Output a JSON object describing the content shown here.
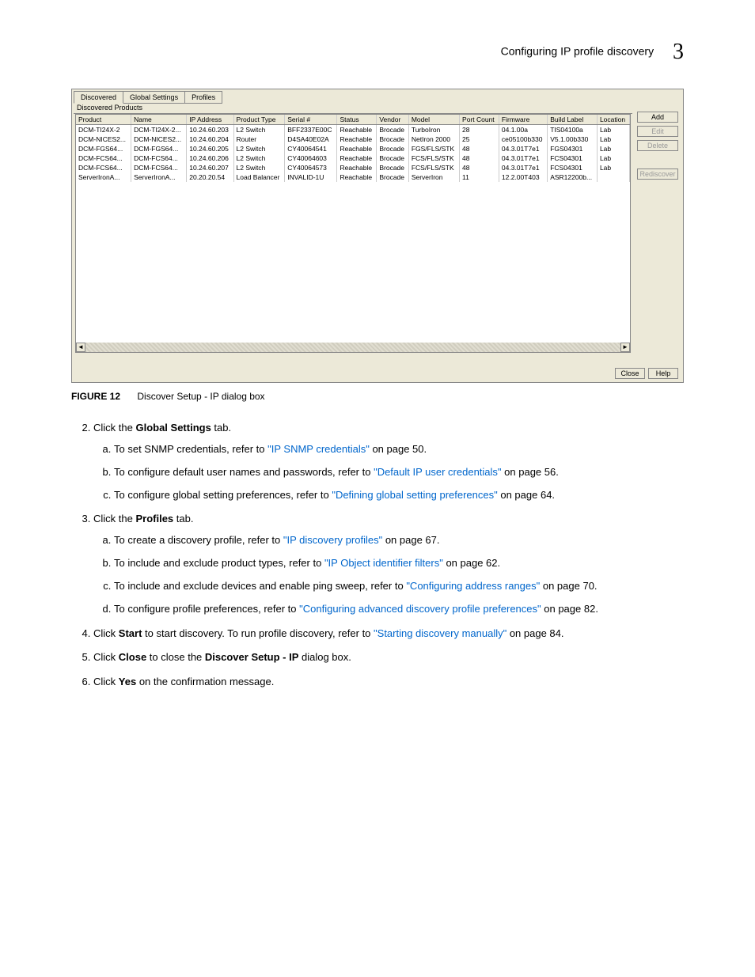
{
  "header": {
    "title": "Configuring IP profile discovery",
    "section": "3"
  },
  "dialog": {
    "tabs": [
      "Discovered",
      "Global Settings",
      "Profiles"
    ],
    "active_tab_index": 0,
    "subheader": "Discovered Products",
    "columns": [
      "Product",
      "Name",
      "IP Address",
      "Product Type",
      "Serial #",
      "Status",
      "Vendor",
      "Model",
      "Port Count",
      "Firmware",
      "Build Label",
      "Location"
    ],
    "rows": [
      {
        "product": "DCM-TI24X-2",
        "name": "DCM-TI24X-2...",
        "ip": "10.24.60.203",
        "type": "L2 Switch",
        "serial": "BFF2337E00C",
        "status": "Reachable",
        "vendor": "Brocade",
        "model": "TurboIron",
        "ports": "28",
        "fw": "04.1.00a",
        "build": "TIS04100a",
        "loc": "Lab"
      },
      {
        "product": "DCM-NICES2...",
        "name": "DCM-NICES2...",
        "ip": "10.24.60.204",
        "type": "Router",
        "serial": "D4SA40E02A",
        "status": "Reachable",
        "vendor": "Brocade",
        "model": "NetIron 2000",
        "ports": "25",
        "fw": "ce05100b330",
        "build": "V5.1.00b330",
        "loc": "Lab"
      },
      {
        "product": "DCM-FGS64...",
        "name": "DCM-FGS64...",
        "ip": "10.24.60.205",
        "type": "L2 Switch",
        "serial": "CY40064541",
        "status": "Reachable",
        "vendor": "Brocade",
        "model": "FGS/FLS/STK",
        "ports": "48",
        "fw": "04.3.01T7e1",
        "build": "FGS04301",
        "loc": "Lab"
      },
      {
        "product": "DCM-FCS64...",
        "name": "DCM-FCS64...",
        "ip": "10.24.60.206",
        "type": "L2 Switch",
        "serial": "CY40064603",
        "status": "Reachable",
        "vendor": "Brocade",
        "model": "FCS/FLS/STK",
        "ports": "48",
        "fw": "04.3.01T7e1",
        "build": "FCS04301",
        "loc": "Lab"
      },
      {
        "product": "DCM-FCS64...",
        "name": "DCM-FCS64...",
        "ip": "10.24.60.207",
        "type": "L2 Switch",
        "serial": "CY40064573",
        "status": "Reachable",
        "vendor": "Brocade",
        "model": "FCS/FLS/STK",
        "ports": "48",
        "fw": "04.3.01T7e1",
        "build": "FCS04301",
        "loc": "Lab"
      },
      {
        "product": "ServerIronA...",
        "name": "ServerIronA...",
        "ip": "20.20.20.54",
        "type": "Load Balancer",
        "serial": "INVALID-1U",
        "status": "Reachable",
        "vendor": "Brocade",
        "model": "ServerIron",
        "ports": "11",
        "fw": "12.2.00T403",
        "build": "ASR12200b...",
        "loc": ""
      }
    ],
    "side_buttons": {
      "add": "Add",
      "edit": "Edit",
      "delete": "Delete",
      "rediscover": "Rediscover"
    },
    "bottom_buttons": {
      "close": "Close",
      "help": "Help"
    }
  },
  "figure": {
    "label": "FIGURE 12",
    "caption": "Discover Setup - IP dialog box"
  },
  "steps": {
    "s2_prefix": "Click the ",
    "s2_bold": "Global Settings",
    "s2_suffix": " tab.",
    "s2a_pre": "To set SNMP credentials, refer to ",
    "s2a_link": "\"IP SNMP credentials\"",
    "s2a_post": " on page 50.",
    "s2b_pre": "To configure default user names and passwords, refer to ",
    "s2b_link": "\"Default IP user credentials\"",
    "s2b_post": " on page 56.",
    "s2c_pre": "To configure global setting preferences, refer to ",
    "s2c_link": "\"Defining global setting preferences\"",
    "s2c_post": " on page 64.",
    "s3_prefix": "Click the ",
    "s3_bold": "Profiles",
    "s3_suffix": " tab.",
    "s3a_pre": "To create a discovery profile, refer to ",
    "s3a_link": "\"IP discovery profiles\"",
    "s3a_post": " on page 67.",
    "s3b_pre": "To include and exclude product types, refer to ",
    "s3b_link": "\"IP Object identifier filters\"",
    "s3b_post": " on page 62.",
    "s3c_pre": "To include and exclude devices and enable ping sweep, refer to ",
    "s3c_link": "\"Configuring address ranges\"",
    "s3c_post": " on page 70.",
    "s3d_pre": "To configure profile preferences, refer to ",
    "s3d_link": "\"Configuring advanced discovery profile preferences\"",
    "s3d_post": " on page 82.",
    "s4_pre": "Click ",
    "s4_bold": "Start",
    "s4_mid": " to start discovery. To run profile discovery, refer to ",
    "s4_link": "\"Starting discovery manually\"",
    "s4_post": " on page 84.",
    "s5_pre": "Click ",
    "s5_bold": "Close",
    "s5_mid": " to close the ",
    "s5_bold2": "Discover Setup - IP",
    "s5_post": " dialog box.",
    "s6_pre": "Click ",
    "s6_bold": "Yes",
    "s6_post": " on the confirmation message."
  }
}
